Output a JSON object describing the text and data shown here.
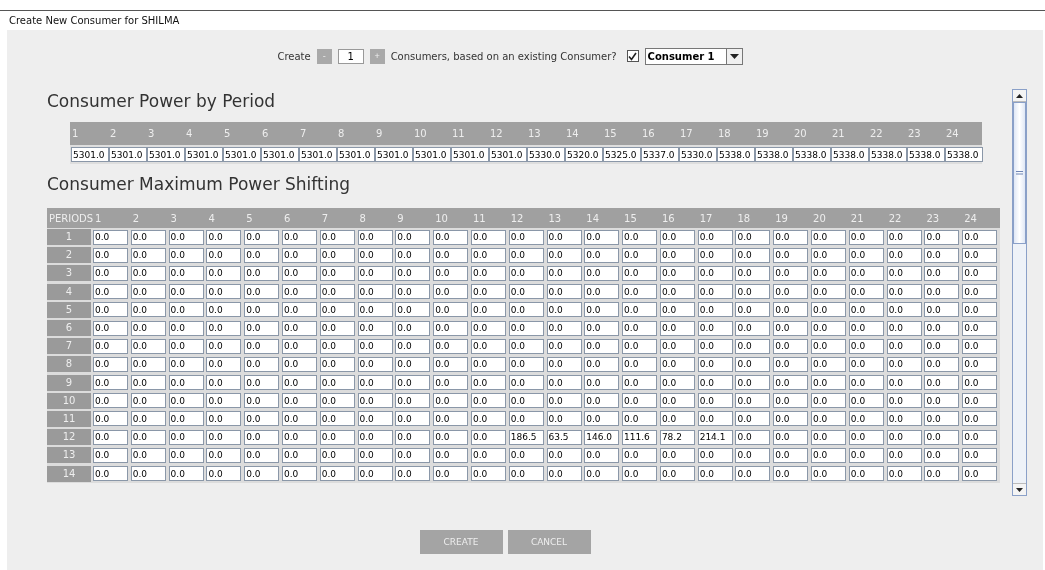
{
  "window": {
    "title": "Create New Consumer for SHILMA"
  },
  "create_bar": {
    "label": "Create",
    "minus": "-",
    "count": "1",
    "plus": "+",
    "question": "Consumers, based on an existing Consumer?",
    "based_on_existing": true,
    "consumer": "Consumer 1"
  },
  "power_by_period": {
    "title": "Consumer Power by Period",
    "columns": [
      "1",
      "2",
      "3",
      "4",
      "5",
      "6",
      "7",
      "8",
      "9",
      "10",
      "11",
      "12",
      "13",
      "14",
      "15",
      "16",
      "17",
      "18",
      "19",
      "20",
      "21",
      "22",
      "23",
      "24"
    ],
    "values": [
      "5301.0",
      "5301.0",
      "5301.0",
      "5301.0",
      "5301.0",
      "5301.0",
      "5301.0",
      "5301.0",
      "5301.0",
      "5301.0",
      "5301.0",
      "5301.0",
      "5330.0",
      "5320.0",
      "5325.0",
      "5337.0",
      "5330.0",
      "5338.0",
      "5338.0",
      "5338.0",
      "5338.0",
      "5338.0",
      "5338.0",
      "5338.0"
    ]
  },
  "max_power_shifting": {
    "title": "Consumer Maximum Power Shifting",
    "corner": "PERIODS",
    "columns": [
      "1",
      "2",
      "3",
      "4",
      "5",
      "6",
      "7",
      "8",
      "9",
      "10",
      "11",
      "12",
      "13",
      "14",
      "15",
      "16",
      "17",
      "18",
      "19",
      "20",
      "21",
      "22",
      "23",
      "24"
    ],
    "rows": [
      {
        "label": "1",
        "values": [
          "0.0",
          "0.0",
          "0.0",
          "0.0",
          "0.0",
          "0.0",
          "0.0",
          "0.0",
          "0.0",
          "0.0",
          "0.0",
          "0.0",
          "0.0",
          "0.0",
          "0.0",
          "0.0",
          "0.0",
          "0.0",
          "0.0",
          "0.0",
          "0.0",
          "0.0",
          "0.0",
          "0.0"
        ]
      },
      {
        "label": "2",
        "values": [
          "0.0",
          "0.0",
          "0.0",
          "0.0",
          "0.0",
          "0.0",
          "0.0",
          "0.0",
          "0.0",
          "0.0",
          "0.0",
          "0.0",
          "0.0",
          "0.0",
          "0.0",
          "0.0",
          "0.0",
          "0.0",
          "0.0",
          "0.0",
          "0.0",
          "0.0",
          "0.0",
          "0.0"
        ]
      },
      {
        "label": "3",
        "values": [
          "0.0",
          "0.0",
          "0.0",
          "0.0",
          "0.0",
          "0.0",
          "0.0",
          "0.0",
          "0.0",
          "0.0",
          "0.0",
          "0.0",
          "0.0",
          "0.0",
          "0.0",
          "0.0",
          "0.0",
          "0.0",
          "0.0",
          "0.0",
          "0.0",
          "0.0",
          "0.0",
          "0.0"
        ]
      },
      {
        "label": "4",
        "values": [
          "0.0",
          "0.0",
          "0.0",
          "0.0",
          "0.0",
          "0.0",
          "0.0",
          "0.0",
          "0.0",
          "0.0",
          "0.0",
          "0.0",
          "0.0",
          "0.0",
          "0.0",
          "0.0",
          "0.0",
          "0.0",
          "0.0",
          "0.0",
          "0.0",
          "0.0",
          "0.0",
          "0.0"
        ]
      },
      {
        "label": "5",
        "values": [
          "0.0",
          "0.0",
          "0.0",
          "0.0",
          "0.0",
          "0.0",
          "0.0",
          "0.0",
          "0.0",
          "0.0",
          "0.0",
          "0.0",
          "0.0",
          "0.0",
          "0.0",
          "0.0",
          "0.0",
          "0.0",
          "0.0",
          "0.0",
          "0.0",
          "0.0",
          "0.0",
          "0.0"
        ]
      },
      {
        "label": "6",
        "values": [
          "0.0",
          "0.0",
          "0.0",
          "0.0",
          "0.0",
          "0.0",
          "0.0",
          "0.0",
          "0.0",
          "0.0",
          "0.0",
          "0.0",
          "0.0",
          "0.0",
          "0.0",
          "0.0",
          "0.0",
          "0.0",
          "0.0",
          "0.0",
          "0.0",
          "0.0",
          "0.0",
          "0.0"
        ]
      },
      {
        "label": "7",
        "values": [
          "0.0",
          "0.0",
          "0.0",
          "0.0",
          "0.0",
          "0.0",
          "0.0",
          "0.0",
          "0.0",
          "0.0",
          "0.0",
          "0.0",
          "0.0",
          "0.0",
          "0.0",
          "0.0",
          "0.0",
          "0.0",
          "0.0",
          "0.0",
          "0.0",
          "0.0",
          "0.0",
          "0.0"
        ]
      },
      {
        "label": "8",
        "values": [
          "0.0",
          "0.0",
          "0.0",
          "0.0",
          "0.0",
          "0.0",
          "0.0",
          "0.0",
          "0.0",
          "0.0",
          "0.0",
          "0.0",
          "0.0",
          "0.0",
          "0.0",
          "0.0",
          "0.0",
          "0.0",
          "0.0",
          "0.0",
          "0.0",
          "0.0",
          "0.0",
          "0.0"
        ]
      },
      {
        "label": "9",
        "values": [
          "0.0",
          "0.0",
          "0.0",
          "0.0",
          "0.0",
          "0.0",
          "0.0",
          "0.0",
          "0.0",
          "0.0",
          "0.0",
          "0.0",
          "0.0",
          "0.0",
          "0.0",
          "0.0",
          "0.0",
          "0.0",
          "0.0",
          "0.0",
          "0.0",
          "0.0",
          "0.0",
          "0.0"
        ]
      },
      {
        "label": "10",
        "values": [
          "0.0",
          "0.0",
          "0.0",
          "0.0",
          "0.0",
          "0.0",
          "0.0",
          "0.0",
          "0.0",
          "0.0",
          "0.0",
          "0.0",
          "0.0",
          "0.0",
          "0.0",
          "0.0",
          "0.0",
          "0.0",
          "0.0",
          "0.0",
          "0.0",
          "0.0",
          "0.0",
          "0.0"
        ]
      },
      {
        "label": "11",
        "values": [
          "0.0",
          "0.0",
          "0.0",
          "0.0",
          "0.0",
          "0.0",
          "0.0",
          "0.0",
          "0.0",
          "0.0",
          "0.0",
          "0.0",
          "0.0",
          "0.0",
          "0.0",
          "0.0",
          "0.0",
          "0.0",
          "0.0",
          "0.0",
          "0.0",
          "0.0",
          "0.0",
          "0.0"
        ]
      },
      {
        "label": "12",
        "values": [
          "0.0",
          "0.0",
          "0.0",
          "0.0",
          "0.0",
          "0.0",
          "0.0",
          "0.0",
          "0.0",
          "0.0",
          "0.0",
          "186.5",
          "63.5",
          "146.0",
          "111.6",
          "78.2",
          "214.1",
          "0.0",
          "0.0",
          "0.0",
          "0.0",
          "0.0",
          "0.0",
          "0.0"
        ]
      },
      {
        "label": "13",
        "values": [
          "0.0",
          "0.0",
          "0.0",
          "0.0",
          "0.0",
          "0.0",
          "0.0",
          "0.0",
          "0.0",
          "0.0",
          "0.0",
          "0.0",
          "0.0",
          "0.0",
          "0.0",
          "0.0",
          "0.0",
          "0.0",
          "0.0",
          "0.0",
          "0.0",
          "0.0",
          "0.0",
          "0.0"
        ]
      },
      {
        "label": "14",
        "values": [
          "0.0",
          "0.0",
          "0.0",
          "0.0",
          "0.0",
          "0.0",
          "0.0",
          "0.0",
          "0.0",
          "0.0",
          "0.0",
          "0.0",
          "0.0",
          "0.0",
          "0.0",
          "0.0",
          "0.0",
          "0.0",
          "0.0",
          "0.0",
          "0.0",
          "0.0",
          "0.0",
          "0.0"
        ]
      }
    ]
  },
  "buttons": [
    "CREATE",
    "CANCEL"
  ]
}
